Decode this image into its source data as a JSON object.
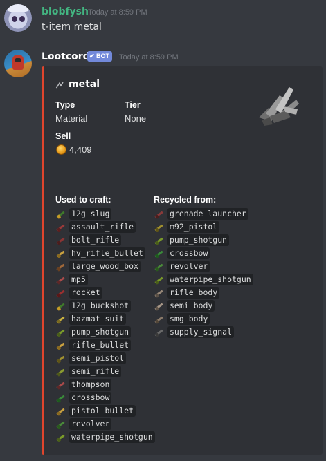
{
  "messages": [
    {
      "username": "blobfysh",
      "username_color": "#43b581",
      "timestamp": "Today at 8:59 PM",
      "text": "t-item metal"
    },
    {
      "username": "Lootcord",
      "username_color": "#ffffff",
      "badge": "BOT",
      "badge_color": "#7289da",
      "timestamp": "Today at 8:59 PM"
    }
  ],
  "embed": {
    "border_color": "#e0452d",
    "title": "metal",
    "type_label": "Type",
    "type_value": "Material",
    "tier_label": "Tier",
    "tier_value": "None",
    "sell_label": "Sell",
    "sell_value": "4,409",
    "used_to_craft_label": "Used to craft:",
    "recycled_from_label": "Recycled from:",
    "used_to_craft": [
      {
        "name": "12g_slug",
        "icon": "shotgun-shell-icon"
      },
      {
        "name": "assault_rifle",
        "icon": "assault-rifle-icon"
      },
      {
        "name": "bolt_rifle",
        "icon": "bolt-rifle-icon"
      },
      {
        "name": "hv_rifle_bullet",
        "icon": "bullet-icon"
      },
      {
        "name": "large_wood_box",
        "icon": "wood-box-icon"
      },
      {
        "name": "mp5",
        "icon": "smg-icon"
      },
      {
        "name": "rocket",
        "icon": "rocket-icon"
      },
      {
        "name": "12g_buckshot",
        "icon": "shotgun-shell-icon"
      },
      {
        "name": "hazmat_suit",
        "icon": "hazmat-suit-icon"
      },
      {
        "name": "pump_shotgun",
        "icon": "shotgun-icon"
      },
      {
        "name": "rifle_bullet",
        "icon": "bullet-icon"
      },
      {
        "name": "semi_pistol",
        "icon": "pistol-icon"
      },
      {
        "name": "semi_rifle",
        "icon": "rifle-icon"
      },
      {
        "name": "thompson",
        "icon": "smg-icon"
      },
      {
        "name": "crossbow",
        "icon": "crossbow-icon"
      },
      {
        "name": "pistol_bullet",
        "icon": "bullet-icon"
      },
      {
        "name": "revolver",
        "icon": "revolver-icon"
      },
      {
        "name": "waterpipe_shotgun",
        "icon": "shotgun-icon"
      }
    ],
    "recycled_from": [
      {
        "name": "grenade_launcher",
        "icon": "grenade-launcher-icon"
      },
      {
        "name": "m92_pistol",
        "icon": "pistol-icon"
      },
      {
        "name": "pump_shotgun",
        "icon": "shotgun-icon"
      },
      {
        "name": "crossbow",
        "icon": "crossbow-icon"
      },
      {
        "name": "revolver",
        "icon": "revolver-icon"
      },
      {
        "name": "waterpipe_shotgun",
        "icon": "shotgun-icon"
      },
      {
        "name": "rifle_body",
        "icon": "rifle-body-icon"
      },
      {
        "name": "semi_body",
        "icon": "semi-body-icon"
      },
      {
        "name": "smg_body",
        "icon": "smg-body-icon"
      },
      {
        "name": "supply_signal",
        "icon": "supply-signal-icon"
      }
    ]
  }
}
